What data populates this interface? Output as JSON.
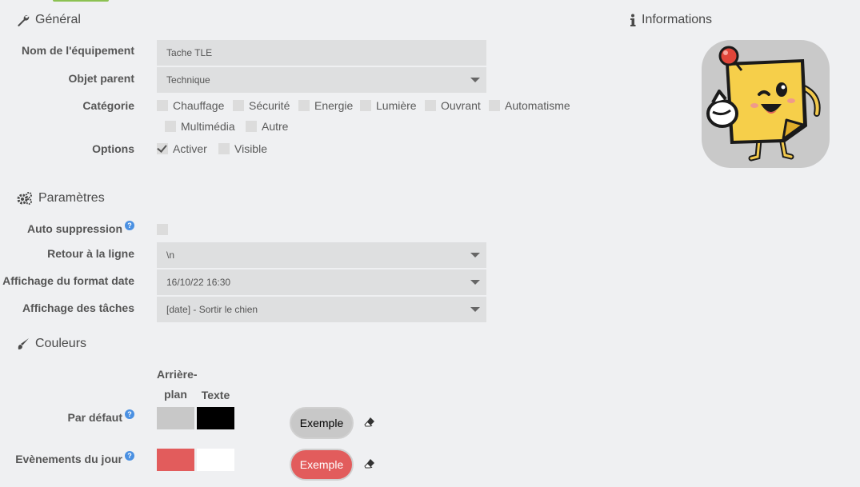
{
  "general": {
    "title": "Général",
    "name_label": "Nom de l'équipement",
    "name_value": "Tache TLE",
    "parent_label": "Objet parent",
    "parent_value": "Technique",
    "category_label": "Catégorie",
    "categories": [
      "Chauffage",
      "Sécurité",
      "Energie",
      "Lumière",
      "Ouvrant",
      "Automatisme",
      "Multimédia",
      "Autre"
    ],
    "options_label": "Options",
    "option_enable": "Activer",
    "option_visible": "Visible"
  },
  "informations": {
    "title": "Informations"
  },
  "parametres": {
    "title": "Paramètres",
    "auto_delete_label": "Auto suppression",
    "line_break_label": "Retour à la ligne",
    "line_break_value": "\\n",
    "date_format_label": "Affichage du format date",
    "date_format_value": "16/10/22 16:30",
    "tasks_display_label": "Affichage des tâches",
    "tasks_display_value": "[date] - Sortir le chien"
  },
  "couleurs": {
    "title": "Couleurs",
    "col_background_line1": "Arrière-",
    "col_background_line2": "plan",
    "col_text": "Texte",
    "default_label": "Par défaut",
    "default_bg": "#c8c8c8",
    "default_text_color": "#000000",
    "default_example": "Exemple",
    "today_label": "Evènements du jour",
    "today_bg": "#e25c5c",
    "today_text_color": "#ffffff",
    "today_example": "Exemple"
  },
  "help_glyph": "?"
}
